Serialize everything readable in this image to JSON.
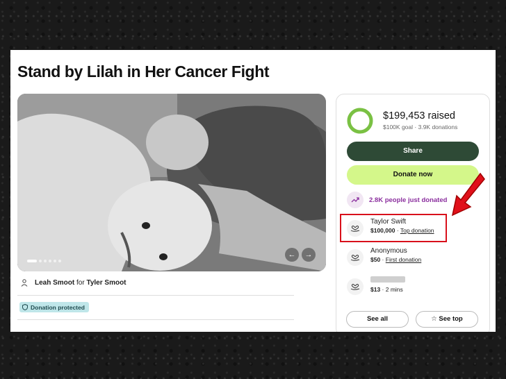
{
  "campaign": {
    "title": "Stand by Lilah in Her Cancer Fight",
    "organizer_name": "Leah Smoot",
    "organizer_for": "for",
    "beneficiary": "Tyler Smoot",
    "badge": "Donation protected"
  },
  "donation_card": {
    "raised": "$199,453 raised",
    "goal": "$100K goal",
    "separator": "·",
    "donations_count": "3.9K donations",
    "progress_fraction": 1.0,
    "share_label": "Share",
    "donate_label": "Donate now",
    "trend_text": "2.8K people just donated",
    "donors": [
      {
        "name": "Taylor Swift",
        "amount": "$100,000",
        "sep": " · ",
        "tag": "Top donation"
      },
      {
        "name": "Anonymous",
        "amount": "$50",
        "sep": " · ",
        "tag": "First donation"
      },
      {
        "name": "",
        "amount": "$13",
        "sep": " · ",
        "tag": "2 mins"
      }
    ],
    "see_all_label": "See all",
    "see_top_label": "See top",
    "star_glyph": "☆"
  },
  "colors": {
    "accent_dark_green": "#2e4a36",
    "accent_lime": "#d4f78a",
    "ring_green": "#7ac143",
    "trend_purple": "#8b2f9e",
    "highlight_red": "#d8101b",
    "arrow_red": "#e0101a"
  },
  "carousel": {
    "prev_glyph": "←",
    "next_glyph": "→"
  }
}
